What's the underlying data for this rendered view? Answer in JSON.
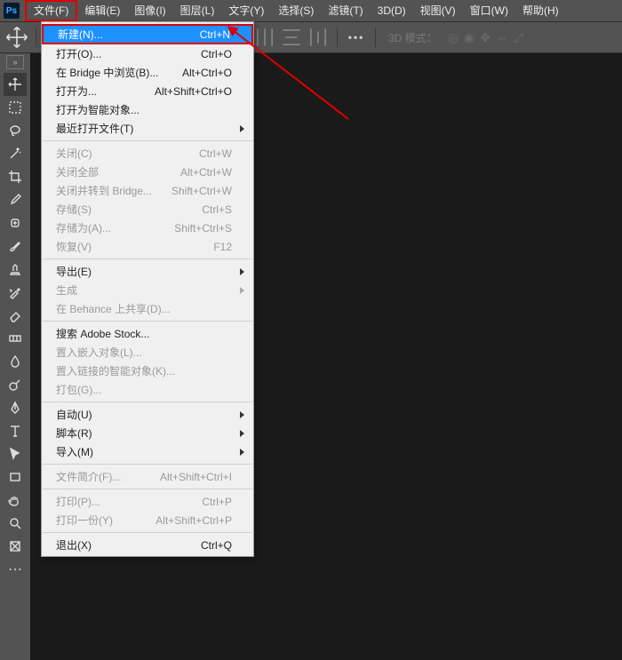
{
  "menubar": {
    "items": [
      "文件(F)",
      "编辑(E)",
      "图像(I)",
      "图层(L)",
      "文字(Y)",
      "选择(S)",
      "滤镜(T)",
      "3D(D)",
      "视图(V)",
      "窗口(W)",
      "帮助(H)"
    ]
  },
  "optionbar": {
    "mode3d_label": "3D 模式："
  },
  "file_menu": {
    "groups": [
      [
        {
          "label": "新建(N)...",
          "shortcut": "Ctrl+N",
          "selected": true
        },
        {
          "label": "打开(O)...",
          "shortcut": "Ctrl+O"
        },
        {
          "label": "在 Bridge 中浏览(B)...",
          "shortcut": "Alt+Ctrl+O"
        },
        {
          "label": "打开为...",
          "shortcut": "Alt+Shift+Ctrl+O"
        },
        {
          "label": "打开为智能对象..."
        },
        {
          "label": "最近打开文件(T)",
          "submenu": true
        }
      ],
      [
        {
          "label": "关闭(C)",
          "shortcut": "Ctrl+W",
          "disabled": true
        },
        {
          "label": "关闭全部",
          "shortcut": "Alt+Ctrl+W",
          "disabled": true
        },
        {
          "label": "关闭并转到 Bridge...",
          "shortcut": "Shift+Ctrl+W",
          "disabled": true
        },
        {
          "label": "存储(S)",
          "shortcut": "Ctrl+S",
          "disabled": true
        },
        {
          "label": "存储为(A)...",
          "shortcut": "Shift+Ctrl+S",
          "disabled": true
        },
        {
          "label": "恢复(V)",
          "shortcut": "F12",
          "disabled": true
        }
      ],
      [
        {
          "label": "导出(E)",
          "submenu": true
        },
        {
          "label": "生成",
          "submenu": true,
          "disabled": true
        },
        {
          "label": "在 Behance 上共享(D)...",
          "disabled": true
        }
      ],
      [
        {
          "label": "搜索 Adobe Stock..."
        },
        {
          "label": "置入嵌入对象(L)...",
          "disabled": true
        },
        {
          "label": "置入链接的智能对象(K)...",
          "disabled": true
        },
        {
          "label": "打包(G)...",
          "disabled": true
        }
      ],
      [
        {
          "label": "自动(U)",
          "submenu": true
        },
        {
          "label": "脚本(R)",
          "submenu": true
        },
        {
          "label": "导入(M)",
          "submenu": true
        }
      ],
      [
        {
          "label": "文件简介(F)...",
          "shortcut": "Alt+Shift+Ctrl+I",
          "disabled": true
        }
      ],
      [
        {
          "label": "打印(P)...",
          "shortcut": "Ctrl+P",
          "disabled": true
        },
        {
          "label": "打印一份(Y)",
          "shortcut": "Alt+Shift+Ctrl+P",
          "disabled": true
        }
      ],
      [
        {
          "label": "退出(X)",
          "shortcut": "Ctrl+Q"
        }
      ]
    ]
  }
}
